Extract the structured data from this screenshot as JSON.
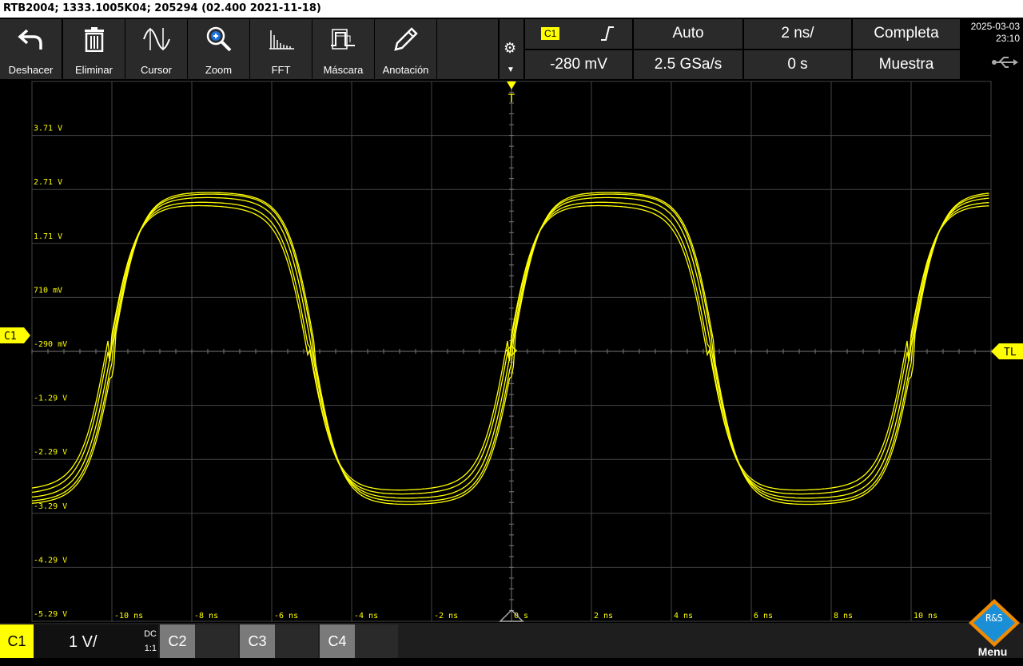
{
  "title_bar": "RTB2004; 1333.1005K04; 205294 (02.400 2021-11-18)",
  "toolbar": [
    {
      "label": "Deshacer",
      "icon": "undo-icon"
    },
    {
      "label": "Eliminar",
      "icon": "trash-icon"
    },
    {
      "label": "Cursor",
      "icon": "cursor-wave-icon"
    },
    {
      "label": "Zoom",
      "icon": "zoom-icon"
    },
    {
      "label": "FFT",
      "icon": "fft-icon"
    },
    {
      "label": "Máscara",
      "icon": "mask-icon"
    },
    {
      "label": "Anotación",
      "icon": "pencil-icon"
    }
  ],
  "settings": {
    "trigger_source": "C1",
    "trigger_mode": "Auto",
    "timebase": "2 ns/",
    "acquisition": "Completa",
    "trigger_level": "-280 mV",
    "sample_rate": "2.5 GSa/s",
    "time_offset": "0 s",
    "acq_mode": "Muestra"
  },
  "clock": {
    "date": "2025-03-03",
    "time": "23:10"
  },
  "markers": {
    "channel_marker": "C1",
    "trigger_marker": "T",
    "trigger_level_marker": "TL"
  },
  "channels": {
    "c1": {
      "label": "C1",
      "scale": "1 V/",
      "coupling": "DC",
      "probe": "1:1"
    },
    "c2": {
      "label": "C2"
    },
    "c3": {
      "label": "C3"
    },
    "c4": {
      "label": "C4"
    }
  },
  "menu_label": "Menu",
  "logo_text": "R&S",
  "colors": {
    "trace": "#ffff00",
    "grid": "#555555",
    "panel": "#2a2a2a"
  },
  "chart_data": {
    "type": "line",
    "title": "",
    "xlabel": "",
    "ylabel": "",
    "x_ticks": [
      "-10 ns",
      "-8 ns",
      "-6 ns",
      "-4 ns",
      "-2 ns",
      "0 s",
      "2 ns",
      "4 ns",
      "6 ns",
      "8 ns",
      "10 ns"
    ],
    "y_ticks": [
      "3.71 V",
      "2.71 V",
      "1.71 V",
      "710 mV",
      "-290 mV",
      "-1.29 V",
      "-2.29 V",
      "-3.29 V",
      "-4.29 V",
      "-5.29 V"
    ],
    "xlim": [
      -12,
      12
    ],
    "ylim": [
      -5.29,
      4.71
    ],
    "grid": true,
    "waveform": {
      "shape": "square-like",
      "period_ns": 10,
      "zero_crossing_ns": [
        -10,
        -5,
        0,
        5,
        10
      ],
      "high_V": 2.55,
      "low_V": -3.0,
      "overlaid_traces": 5
    }
  }
}
